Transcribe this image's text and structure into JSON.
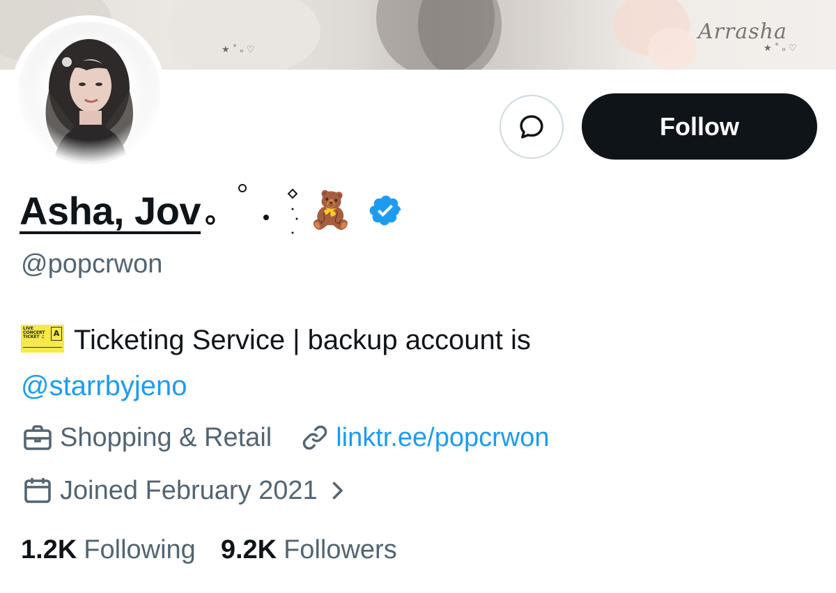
{
  "banner": {
    "signature": "Arrasha"
  },
  "profile": {
    "display_name_part1": "Asha, Jov",
    "display_name_part2": "。",
    "handle": "@popcrwon",
    "bio_text": "Ticketing Service | backup account is",
    "bio_mention": "@starrbyjeno",
    "bio_ticket_lines": [
      "LIVE",
      "CONCERT",
      "TICKET ♫"
    ],
    "bio_ticket_zone": "A",
    "category": "Shopping & Retail",
    "website": "linktr.ee/popcrwon",
    "joined": "Joined February 2021"
  },
  "actions": {
    "follow_label": "Follow",
    "message_icon": "message-icon"
  },
  "stats": {
    "following_count": "1.2K",
    "following_label": "Following",
    "followers_count": "9.2K",
    "followers_label": "Followers"
  },
  "colors": {
    "accent": "#1d9bf0",
    "text_primary": "#0f1419",
    "text_secondary": "#536471",
    "follow_bg": "#0f1419"
  }
}
